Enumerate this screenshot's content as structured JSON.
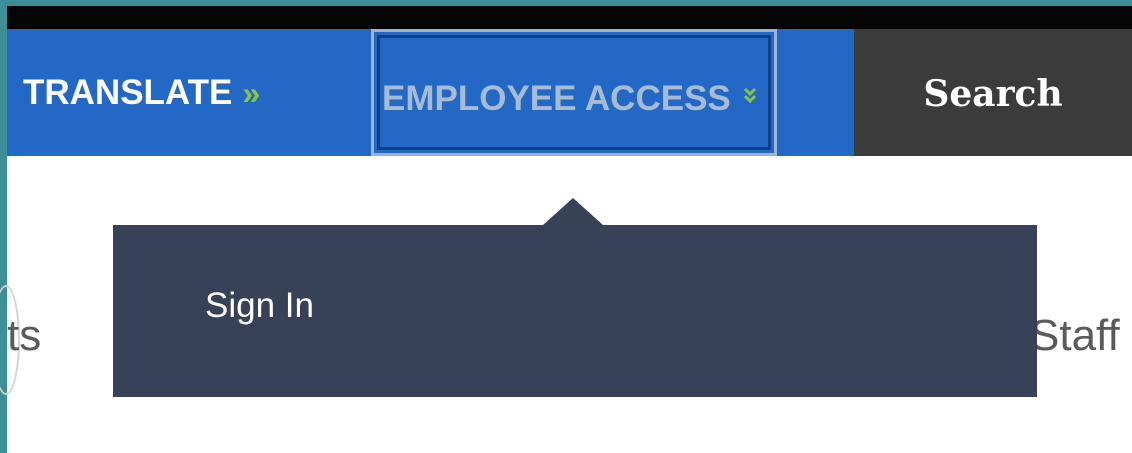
{
  "nav": {
    "translate_label": "TRANSLATE",
    "translate_chevron": "»",
    "employee_access_label": "EMPLOYEE ACCESS",
    "employee_access_chevron": "»",
    "search_label": "Search"
  },
  "dropdown": {
    "items": [
      {
        "label": "Sign In"
      }
    ]
  },
  "background": {
    "left_fragment": "ts",
    "right_fragment": "Staff"
  },
  "colors": {
    "nav_blue": "#2268c4",
    "nav_dark": "#3b3b3b",
    "accent_green": "#8bc53f",
    "dropdown_bg": "#374258",
    "focus_outline": "#9bb4d6"
  },
  "icons": {
    "translate_chevron": "double-chevron-right-icon",
    "employee_access_chevron": "double-chevron-down-icon"
  }
}
